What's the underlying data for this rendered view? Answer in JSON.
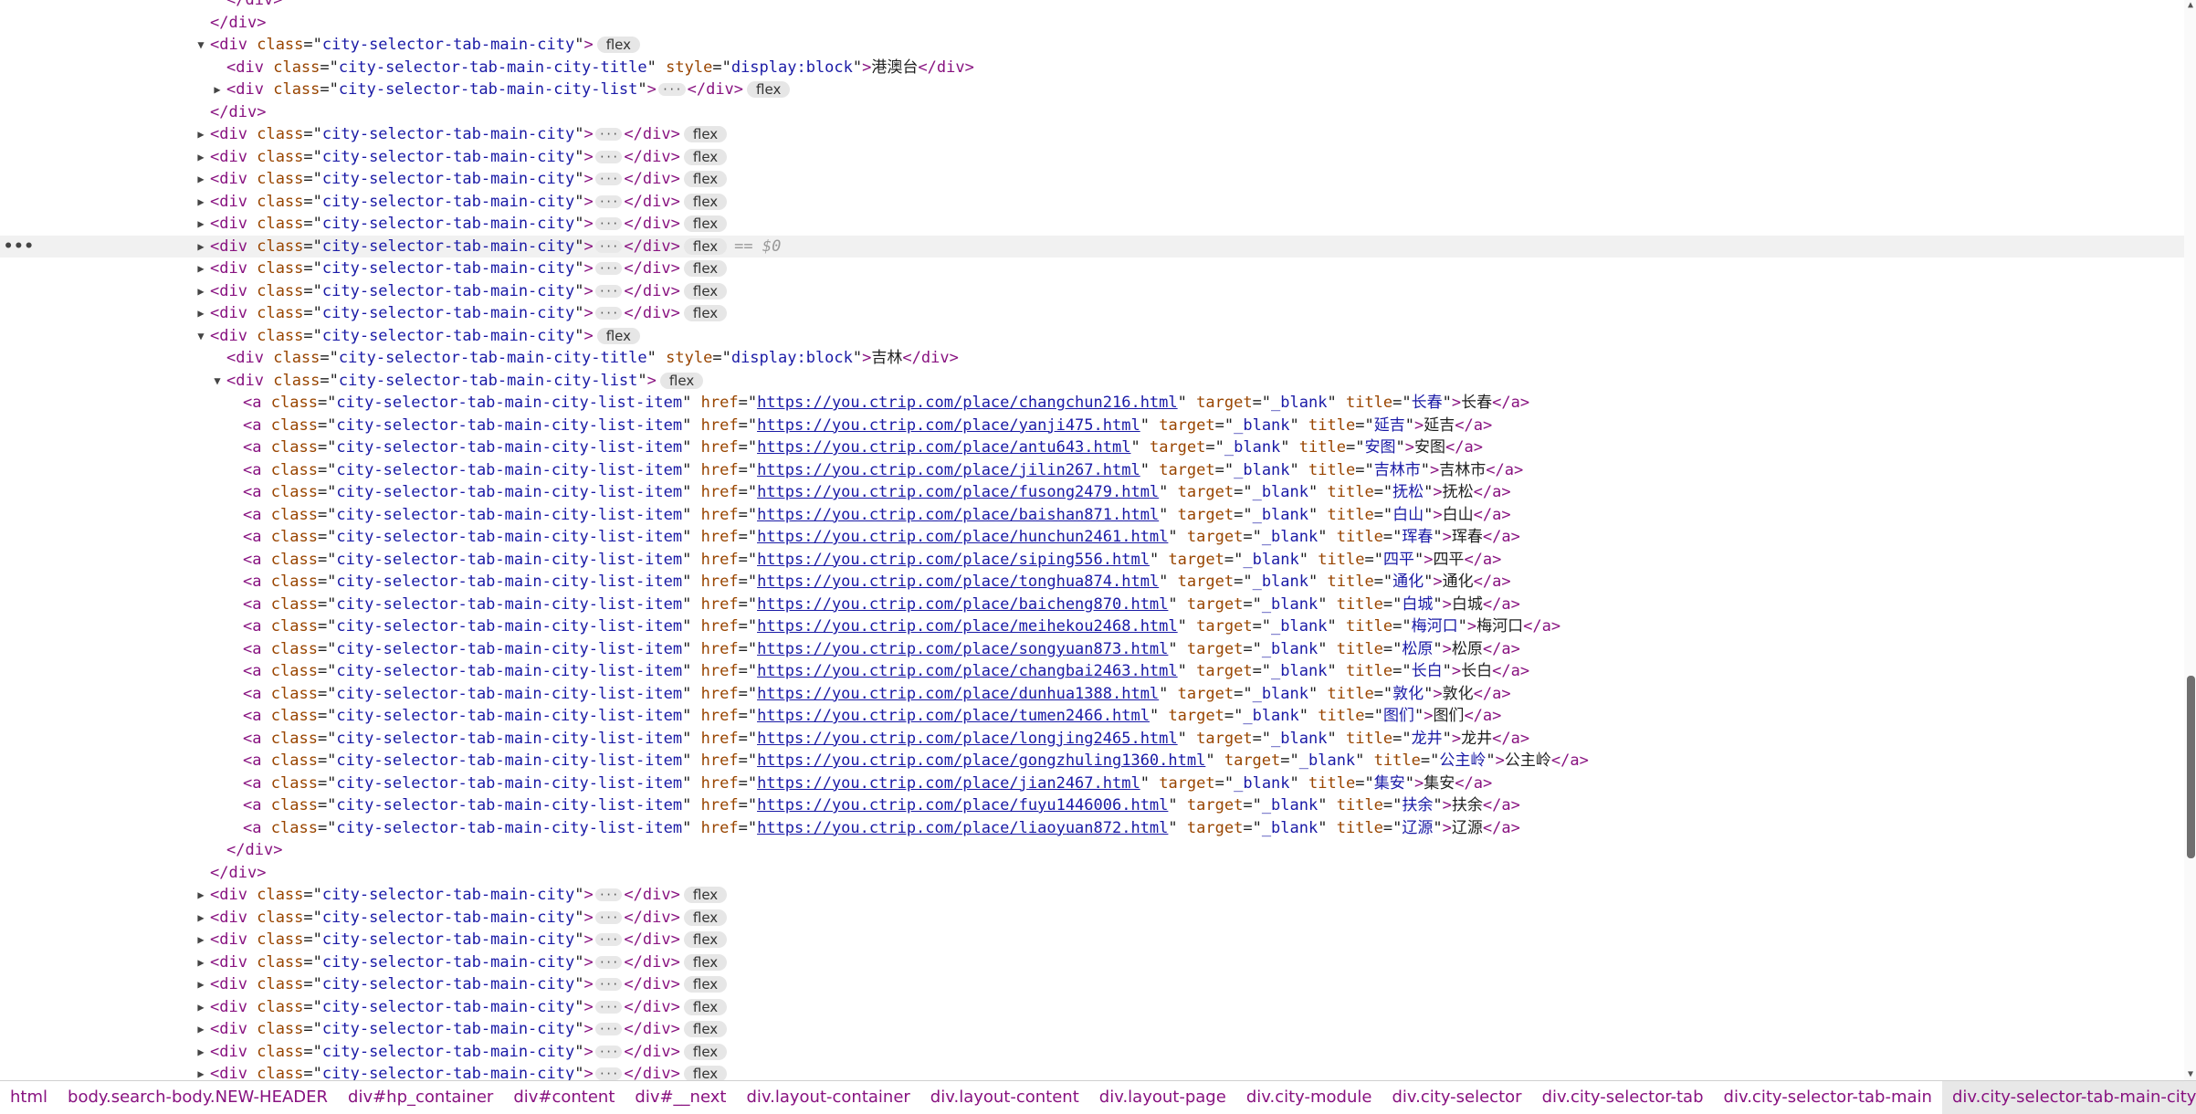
{
  "dom_tree": {
    "node_marker": "== $0",
    "rows": [
      {
        "depth": 2,
        "kind": "close",
        "tag": "div"
      },
      {
        "depth": 1,
        "kind": "close",
        "tag": "div"
      },
      {
        "depth": 1,
        "kind": "open",
        "arrow": "down",
        "tag": "div",
        "cls": "city-selector-tab-main-city",
        "badge": "flex"
      },
      {
        "depth": 2,
        "kind": "element",
        "tag": "div",
        "cls": "city-selector-tab-main-city-title",
        "style": "display:block",
        "text": "港澳台"
      },
      {
        "depth": 2,
        "kind": "collapsed",
        "arrow": "right",
        "tag": "div",
        "cls": "city-selector-tab-main-city-list",
        "badge": "flex"
      },
      {
        "depth": 1,
        "kind": "close",
        "tag": "div"
      },
      {
        "depth": 1,
        "kind": "collapsed",
        "arrow": "right",
        "tag": "div",
        "cls": "city-selector-tab-main-city",
        "badge": "flex"
      },
      {
        "depth": 1,
        "kind": "collapsed",
        "arrow": "right",
        "tag": "div",
        "cls": "city-selector-tab-main-city",
        "badge": "flex"
      },
      {
        "depth": 1,
        "kind": "collapsed",
        "arrow": "right",
        "tag": "div",
        "cls": "city-selector-tab-main-city",
        "badge": "flex"
      },
      {
        "depth": 1,
        "kind": "collapsed",
        "arrow": "right",
        "tag": "div",
        "cls": "city-selector-tab-main-city",
        "badge": "flex"
      },
      {
        "depth": 1,
        "kind": "collapsed",
        "arrow": "right",
        "tag": "div",
        "cls": "city-selector-tab-main-city",
        "badge": "flex"
      },
      {
        "depth": 1,
        "kind": "collapsed",
        "arrow": "right",
        "tag": "div",
        "cls": "city-selector-tab-main-city",
        "badge": "flex",
        "selected": true
      },
      {
        "depth": 1,
        "kind": "collapsed",
        "arrow": "right",
        "tag": "div",
        "cls": "city-selector-tab-main-city",
        "badge": "flex"
      },
      {
        "depth": 1,
        "kind": "collapsed",
        "arrow": "right",
        "tag": "div",
        "cls": "city-selector-tab-main-city",
        "badge": "flex"
      },
      {
        "depth": 1,
        "kind": "collapsed",
        "arrow": "right",
        "tag": "div",
        "cls": "city-selector-tab-main-city",
        "badge": "flex"
      },
      {
        "depth": 1,
        "kind": "open",
        "arrow": "down",
        "tag": "div",
        "cls": "city-selector-tab-main-city",
        "badge": "flex"
      },
      {
        "depth": 2,
        "kind": "element",
        "tag": "div",
        "cls": "city-selector-tab-main-city-title",
        "style": "display:block",
        "text": "吉林"
      },
      {
        "depth": 2,
        "kind": "open",
        "arrow": "down",
        "tag": "div",
        "cls": "city-selector-tab-main-city-list",
        "badge": "flex"
      },
      {
        "depth": 3,
        "kind": "link",
        "tag": "a",
        "cls": "city-selector-tab-main-city-list-item",
        "href": "https://you.ctrip.com/place/changchun216.html",
        "target": "_blank",
        "title": "长春",
        "text": "长春"
      },
      {
        "depth": 3,
        "kind": "link",
        "tag": "a",
        "cls": "city-selector-tab-main-city-list-item",
        "href": "https://you.ctrip.com/place/yanji475.html",
        "target": "_blank",
        "title": "延吉",
        "text": "延吉"
      },
      {
        "depth": 3,
        "kind": "link",
        "tag": "a",
        "cls": "city-selector-tab-main-city-list-item",
        "href": "https://you.ctrip.com/place/antu643.html",
        "target": "_blank",
        "title": "安图",
        "text": "安图"
      },
      {
        "depth": 3,
        "kind": "link",
        "tag": "a",
        "cls": "city-selector-tab-main-city-list-item",
        "href": "https://you.ctrip.com/place/jilin267.html",
        "target": "_blank",
        "title": "吉林市",
        "text": "吉林市"
      },
      {
        "depth": 3,
        "kind": "link",
        "tag": "a",
        "cls": "city-selector-tab-main-city-list-item",
        "href": "https://you.ctrip.com/place/fusong2479.html",
        "target": "_blank",
        "title": "抚松",
        "text": "抚松"
      },
      {
        "depth": 3,
        "kind": "link",
        "tag": "a",
        "cls": "city-selector-tab-main-city-list-item",
        "href": "https://you.ctrip.com/place/baishan871.html",
        "target": "_blank",
        "title": "白山",
        "text": "白山"
      },
      {
        "depth": 3,
        "kind": "link",
        "tag": "a",
        "cls": "city-selector-tab-main-city-list-item",
        "href": "https://you.ctrip.com/place/hunchun2461.html",
        "target": "_blank",
        "title": "珲春",
        "text": "珲春"
      },
      {
        "depth": 3,
        "kind": "link",
        "tag": "a",
        "cls": "city-selector-tab-main-city-list-item",
        "href": "https://you.ctrip.com/place/siping556.html",
        "target": "_blank",
        "title": "四平",
        "text": "四平"
      },
      {
        "depth": 3,
        "kind": "link",
        "tag": "a",
        "cls": "city-selector-tab-main-city-list-item",
        "href": "https://you.ctrip.com/place/tonghua874.html",
        "target": "_blank",
        "title": "通化",
        "text": "通化"
      },
      {
        "depth": 3,
        "kind": "link",
        "tag": "a",
        "cls": "city-selector-tab-main-city-list-item",
        "href": "https://you.ctrip.com/place/baicheng870.html",
        "target": "_blank",
        "title": "白城",
        "text": "白城"
      },
      {
        "depth": 3,
        "kind": "link",
        "tag": "a",
        "cls": "city-selector-tab-main-city-list-item",
        "href": "https://you.ctrip.com/place/meihekou2468.html",
        "target": "_blank",
        "title": "梅河口",
        "text": "梅河口"
      },
      {
        "depth": 3,
        "kind": "link",
        "tag": "a",
        "cls": "city-selector-tab-main-city-list-item",
        "href": "https://you.ctrip.com/place/songyuan873.html",
        "target": "_blank",
        "title": "松原",
        "text": "松原"
      },
      {
        "depth": 3,
        "kind": "link",
        "tag": "a",
        "cls": "city-selector-tab-main-city-list-item",
        "href": "https://you.ctrip.com/place/changbai2463.html",
        "target": "_blank",
        "title": "长白",
        "text": "长白"
      },
      {
        "depth": 3,
        "kind": "link",
        "tag": "a",
        "cls": "city-selector-tab-main-city-list-item",
        "href": "https://you.ctrip.com/place/dunhua1388.html",
        "target": "_blank",
        "title": "敦化",
        "text": "敦化"
      },
      {
        "depth": 3,
        "kind": "link",
        "tag": "a",
        "cls": "city-selector-tab-main-city-list-item",
        "href": "https://you.ctrip.com/place/tumen2466.html",
        "target": "_blank",
        "title": "图们",
        "text": "图们"
      },
      {
        "depth": 3,
        "kind": "link",
        "tag": "a",
        "cls": "city-selector-tab-main-city-list-item",
        "href": "https://you.ctrip.com/place/longjing2465.html",
        "target": "_blank",
        "title": "龙井",
        "text": "龙井"
      },
      {
        "depth": 3,
        "kind": "link",
        "tag": "a",
        "cls": "city-selector-tab-main-city-list-item",
        "href": "https://you.ctrip.com/place/gongzhuling1360.html",
        "target": "_blank",
        "title": "公主岭",
        "text": "公主岭"
      },
      {
        "depth": 3,
        "kind": "link",
        "tag": "a",
        "cls": "city-selector-tab-main-city-list-item",
        "href": "https://you.ctrip.com/place/jian2467.html",
        "target": "_blank",
        "title": "集安",
        "text": "集安"
      },
      {
        "depth": 3,
        "kind": "link",
        "tag": "a",
        "cls": "city-selector-tab-main-city-list-item",
        "href": "https://you.ctrip.com/place/fuyu1446006.html",
        "target": "_blank",
        "title": "扶余",
        "text": "扶余"
      },
      {
        "depth": 3,
        "kind": "link",
        "tag": "a",
        "cls": "city-selector-tab-main-city-list-item",
        "href": "https://you.ctrip.com/place/liaoyuan872.html",
        "target": "_blank",
        "title": "辽源",
        "text": "辽源"
      },
      {
        "depth": 2,
        "kind": "close",
        "tag": "div"
      },
      {
        "depth": 1,
        "kind": "close",
        "tag": "div"
      },
      {
        "depth": 1,
        "kind": "collapsed",
        "arrow": "right",
        "tag": "div",
        "cls": "city-selector-tab-main-city",
        "badge": "flex"
      },
      {
        "depth": 1,
        "kind": "collapsed",
        "arrow": "right",
        "tag": "div",
        "cls": "city-selector-tab-main-city",
        "badge": "flex"
      },
      {
        "depth": 1,
        "kind": "collapsed",
        "arrow": "right",
        "tag": "div",
        "cls": "city-selector-tab-main-city",
        "badge": "flex"
      },
      {
        "depth": 1,
        "kind": "collapsed",
        "arrow": "right",
        "tag": "div",
        "cls": "city-selector-tab-main-city",
        "badge": "flex"
      },
      {
        "depth": 1,
        "kind": "collapsed",
        "arrow": "right",
        "tag": "div",
        "cls": "city-selector-tab-main-city",
        "badge": "flex"
      },
      {
        "depth": 1,
        "kind": "collapsed",
        "arrow": "right",
        "tag": "div",
        "cls": "city-selector-tab-main-city",
        "badge": "flex"
      },
      {
        "depth": 1,
        "kind": "collapsed",
        "arrow": "right",
        "tag": "div",
        "cls": "city-selector-tab-main-city",
        "badge": "flex"
      },
      {
        "depth": 1,
        "kind": "collapsed",
        "arrow": "right",
        "tag": "div",
        "cls": "city-selector-tab-main-city",
        "badge": "flex"
      },
      {
        "depth": 1,
        "kind": "collapsed",
        "arrow": "right",
        "tag": "div",
        "cls": "city-selector-tab-main-city",
        "badge": "flex"
      }
    ]
  },
  "breadcrumbs": [
    "html",
    "body.search-body.NEW-HEADER",
    "div#hp_container",
    "div#content",
    "div#__next",
    "div.layout-container",
    "div.layout-content",
    "div.layout-page",
    "div.city-module",
    "div.city-selector",
    "div.city-selector-tab",
    "div.city-selector-tab-main",
    "div.city-selector-tab-main-city"
  ],
  "active_breadcrumb": 12,
  "icons": {
    "row_menu": "ellipsis-icon",
    "expand": "triangle-right-icon",
    "collapse": "triangle-down-icon"
  },
  "colors": {
    "tag": "#881280",
    "attr_name": "#994500",
    "attr_value": "#1a1aa6",
    "selected_row": "#f1f1f1"
  }
}
